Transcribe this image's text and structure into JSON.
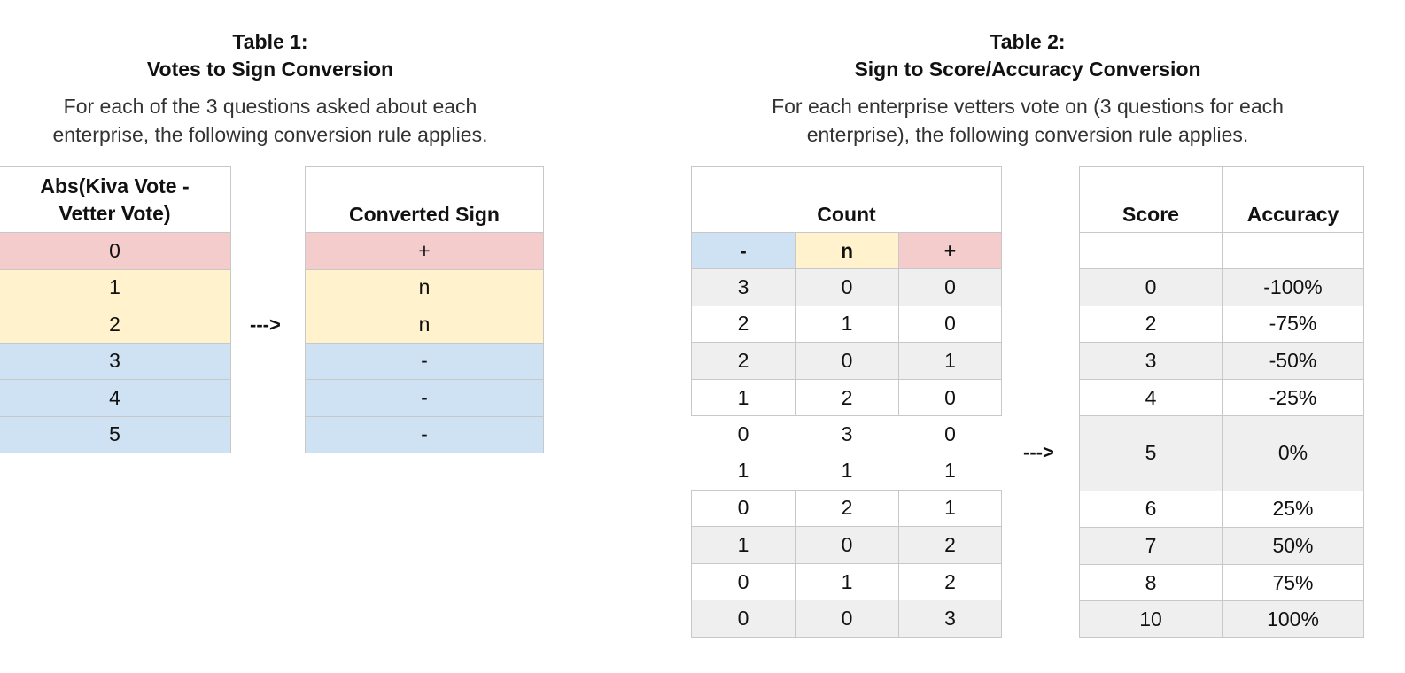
{
  "table1": {
    "title_line1": "Table 1:",
    "title_line2": "Votes to Sign Conversion",
    "desc_line1": "For each of the 3 questions asked about each",
    "desc_line2": "enterprise, the following conversion rule applies.",
    "left_header_line1": "Abs(Kiva Vote -",
    "left_header_line2": "Vetter Vote)",
    "right_header": "Converted Sign",
    "arrow": "--->",
    "rows": [
      {
        "value": "0",
        "sign": "+"
      },
      {
        "value": "1",
        "sign": "n"
      },
      {
        "value": "2",
        "sign": "n"
      },
      {
        "value": "3",
        "sign": "-"
      },
      {
        "value": "4",
        "sign": "-"
      },
      {
        "value": "5",
        "sign": "-"
      }
    ]
  },
  "table2": {
    "title_line1": "Table 2:",
    "title_line2": "Sign to Score/Accuracy Conversion",
    "desc_line1": "For each enterprise vetters vote on (3 questions for each",
    "desc_line2": "enterprise), the following conversion rule applies.",
    "count_header": "Count",
    "sub_headers": [
      "-",
      "n",
      "+"
    ],
    "score_header": "Score",
    "accuracy_header": "Accuracy",
    "arrow": "--->",
    "count_rows": [
      [
        "3",
        "0",
        "0"
      ],
      [
        "2",
        "1",
        "0"
      ],
      [
        "2",
        "0",
        "1"
      ],
      [
        "1",
        "2",
        "0"
      ],
      [
        "0",
        "3",
        "0"
      ],
      [
        "1",
        "1",
        "1"
      ],
      [
        "0",
        "2",
        "1"
      ],
      [
        "1",
        "0",
        "2"
      ],
      [
        "0",
        "1",
        "2"
      ],
      [
        "0",
        "0",
        "3"
      ]
    ],
    "score_rows": [
      {
        "score": "0",
        "accuracy": "-100%"
      },
      {
        "score": "2",
        "accuracy": "-75%"
      },
      {
        "score": "3",
        "accuracy": "-50%"
      },
      {
        "score": "4",
        "accuracy": "-25%"
      },
      {
        "score": "5",
        "accuracy": "0%"
      },
      {
        "score": "6",
        "accuracy": "25%"
      },
      {
        "score": "7",
        "accuracy": "50%"
      },
      {
        "score": "8",
        "accuracy": "75%"
      },
      {
        "score": "10",
        "accuracy": "100%"
      }
    ]
  }
}
